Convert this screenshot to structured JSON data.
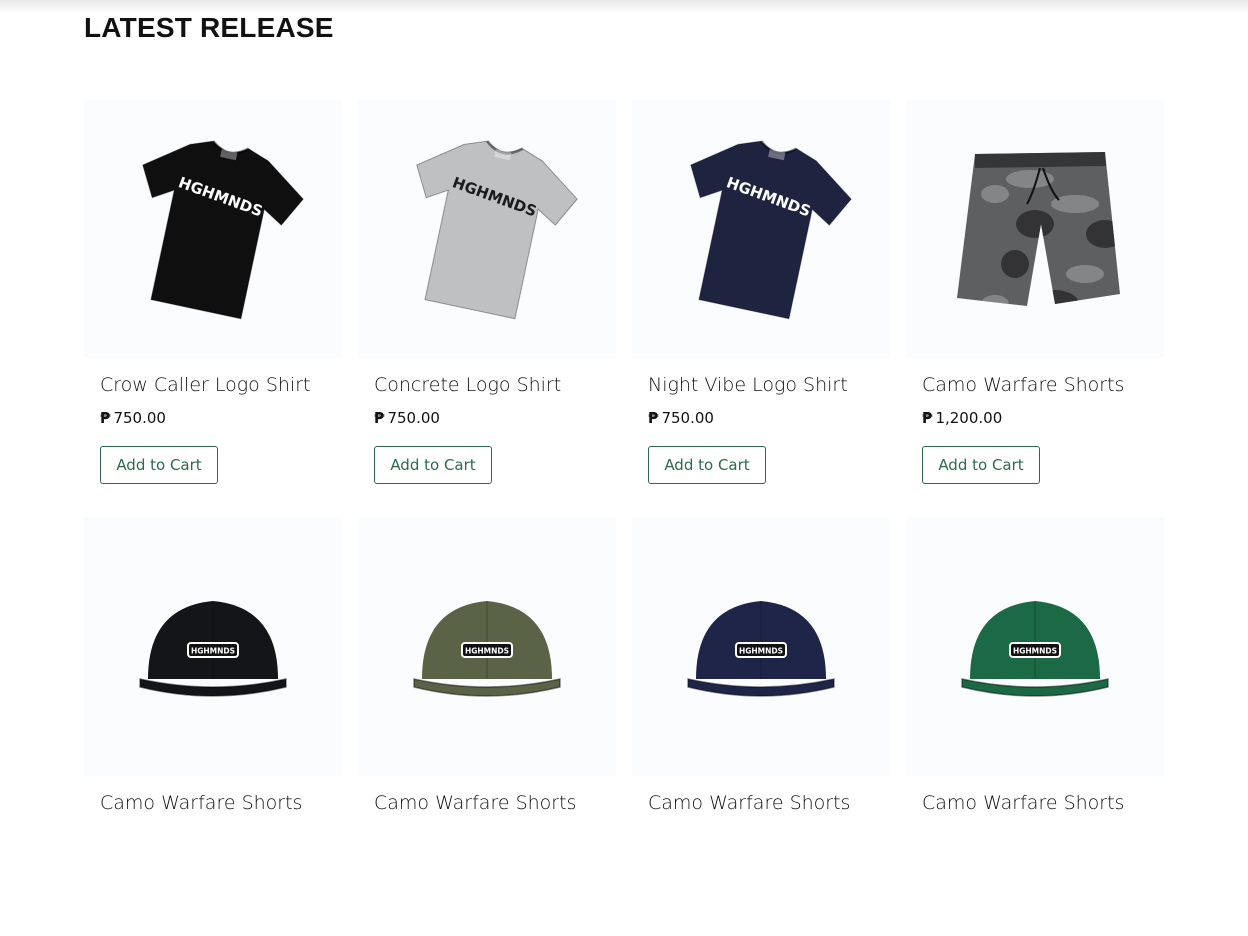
{
  "section": {
    "title": "LATEST RELEASE"
  },
  "currency_symbol": "₱",
  "products": [
    {
      "name": "Crow Caller Logo Shirt",
      "price": "750.00",
      "button": "Add to Cart",
      "type": "shirt",
      "color": "#0f0f10",
      "print": "#ffffff",
      "logo": "HGHMNDS"
    },
    {
      "name": "Concrete Logo Shirt",
      "price": "750.00",
      "button": "Add to Cart",
      "type": "shirt",
      "color": "#bfc0c1",
      "print": "#1b1b1b",
      "logo": "HGHMNDS"
    },
    {
      "name": "Night Vibe Logo Shirt",
      "price": "750.00",
      "button": "Add to Cart",
      "type": "shirt",
      "color": "#1e2340",
      "print": "#ffffff",
      "logo": "HGHMNDS"
    },
    {
      "name": "Camo Warfare Shorts",
      "price": "1,200.00",
      "button": "Add to Cart",
      "type": "shorts",
      "color": "#5d5f61",
      "print": "#2b2c2e",
      "logo": ""
    },
    {
      "name": "Camo Warfare Shorts",
      "price": "",
      "button": "",
      "type": "cap",
      "color": "#141518",
      "print": "#ffffff",
      "logo": "HGHMNDS"
    },
    {
      "name": "Camo Warfare Shorts",
      "price": "",
      "button": "",
      "type": "cap",
      "color": "#5b6346",
      "print": "#ffffff",
      "logo": "HGHMNDS"
    },
    {
      "name": "Camo Warfare Shorts",
      "price": "",
      "button": "",
      "type": "cap",
      "color": "#1f2549",
      "print": "#ffffff",
      "logo": "HGHMNDS"
    },
    {
      "name": "Camo Warfare Shorts",
      "price": "",
      "button": "",
      "type": "cap",
      "color": "#1b6a45",
      "print": "#ffffff",
      "logo": "HGHMNDS"
    }
  ]
}
